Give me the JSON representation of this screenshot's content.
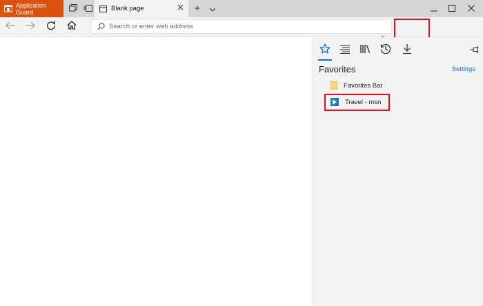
{
  "titlebar": {
    "app_guard_label": "Application Guard",
    "tab_title": "Blank page",
    "new_tab_symbol": "+",
    "tab_list_symbol": "⌵",
    "window_controls": [
      "minimize-icon",
      "maximize-icon",
      "close-icon"
    ]
  },
  "navbar": {
    "address_placeholder": "Search or enter web address",
    "address_value": "",
    "more_label": "···"
  },
  "hub": {
    "title": "Favorites",
    "settings_label": "Settings",
    "tabs": [
      "favorites-icon",
      "reading-list-icon",
      "books-icon",
      "history-icon",
      "downloads-icon"
    ],
    "items": [
      {
        "label": "Favorites Bar",
        "icon": "folder-icon"
      },
      {
        "label": "Travel - msn",
        "icon": "msn-travel-icon"
      }
    ]
  },
  "colors": {
    "accent": "#0a6ed1",
    "app_guard": "#d9530f",
    "highlight": "#e5101c",
    "panel_bg": "#f2f2f2"
  }
}
